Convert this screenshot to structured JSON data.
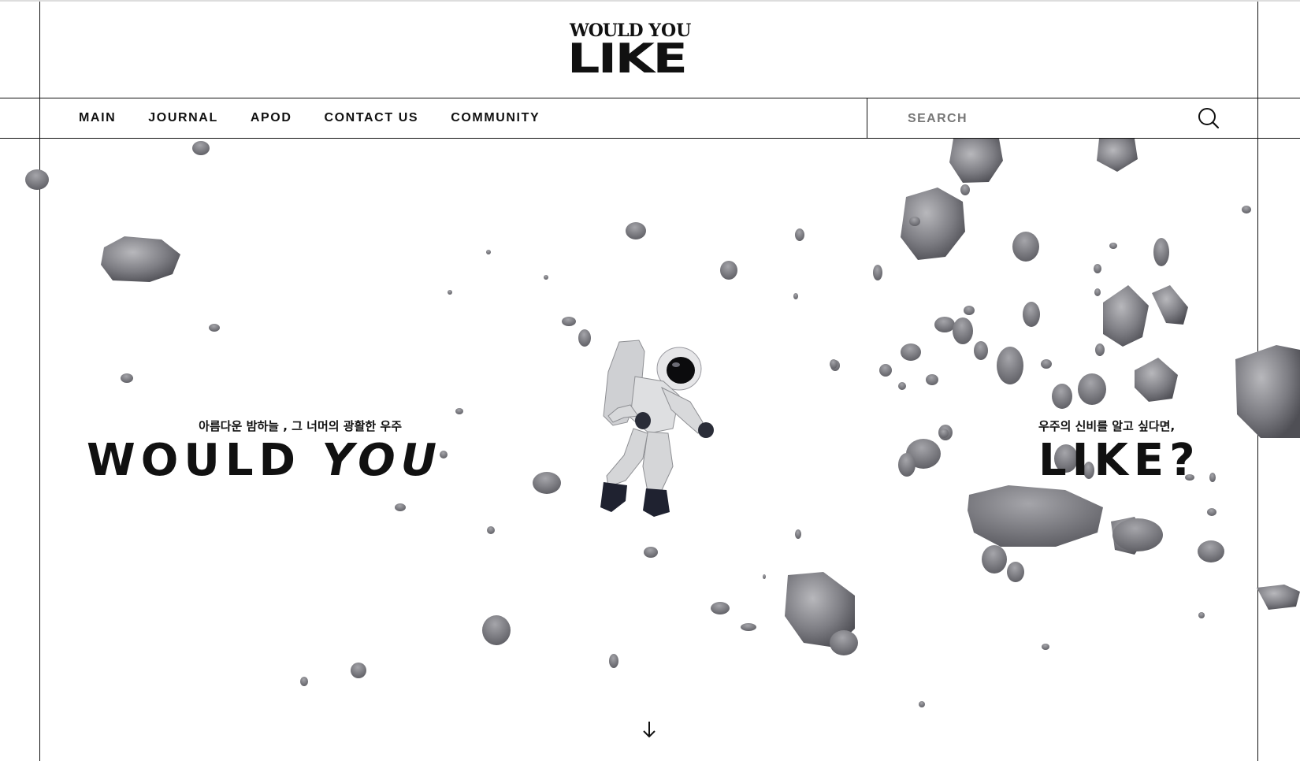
{
  "brand": {
    "logo_line1_a": "WOULD",
    "logo_line1_b": " YOU",
    "logo_line2": "LIKE"
  },
  "nav": {
    "items": [
      "MAIN",
      "JOURNAL",
      "APOD",
      "CONTACT US",
      "COMMUNITY"
    ]
  },
  "search": {
    "placeholder": "SEARCH",
    "icon": "search-icon"
  },
  "hero": {
    "left_subtitle": "아름다운 밤하늘 , 그 너머의 광활한 우주",
    "left_title_a": "WOULD ",
    "left_title_b": "YOU",
    "right_subtitle": "우주의 신비를 알고 싶다면,",
    "right_title": "LIKE?",
    "scroll_icon": "arrow-down-icon"
  }
}
